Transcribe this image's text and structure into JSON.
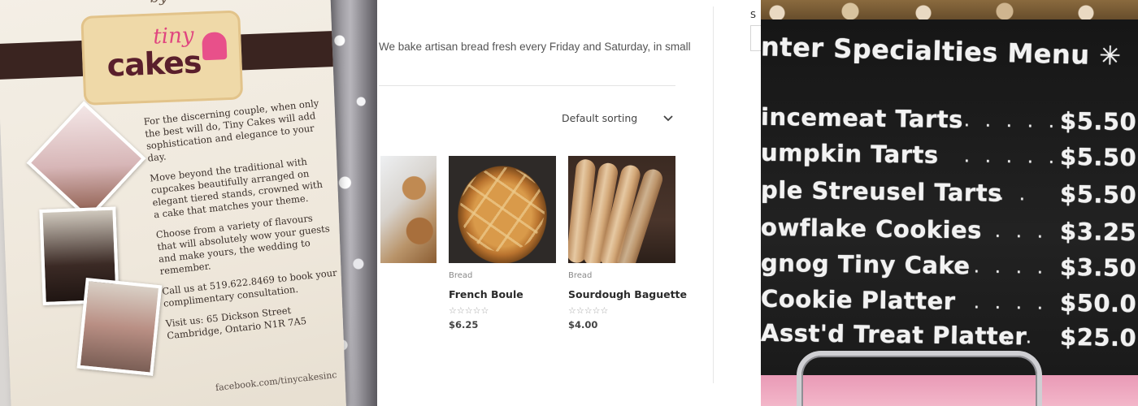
{
  "left_photo": {
    "flyer_by": "by",
    "logo_word_1": "tiny",
    "logo_word_2": "cakes",
    "paragraphs": [
      "For the discerning couple, when only the best will do, Tiny Cakes will add sophistication and elegance to your day.",
      "Move beyond the traditional with cupcakes beautifully arranged on elegant tiered stands, crowned with a cake that matches your theme.",
      "Choose from a variety of flavours that will absolutely wow your guests and make yours, the wedding to remember.",
      "Call us at 519.622.8469 to book your complimentary consultation.",
      "Visit us: 65 Dickson Street Cambridge, Ontario N1R 7A5"
    ],
    "footer": "facebook.com/tinycakesinc"
  },
  "shop": {
    "intro": "We bake artisan bread fresh every Friday and Saturday, in small",
    "sorting": {
      "selected": "Default sorting"
    },
    "products": [
      {
        "category": "Bread",
        "name": "French Boule",
        "price": "$6.25",
        "rating": 0
      },
      {
        "category": "Bread",
        "name": "Sourdough Baguette",
        "price": "$4.00",
        "rating": 0
      }
    ]
  },
  "sidebar": {
    "label": "S"
  },
  "right_photo": {
    "title": "nter Specialties Menu ✳",
    "items": [
      {
        "name": "incemeat Tarts",
        "price": "$5.50"
      },
      {
        "name": "umpkin Tarts",
        "price": "$5.50"
      },
      {
        "name": "ple Streusel Tarts",
        "price": "$5.50"
      },
      {
        "name": "owflake Cookies",
        "price": "$3.25"
      },
      {
        "name": "gnog Tiny Cake",
        "price": "$3.50"
      },
      {
        "name": "Cookie Platter",
        "price": "$50.0"
      },
      {
        "name": "Asst'd Treat Platter",
        "price": "$25.0"
      }
    ]
  },
  "colors": {
    "text_primary": "#2a2a2a",
    "text_muted": "#888888",
    "star_empty": "#a5a5a5",
    "chalk": "#f2f2f2"
  }
}
